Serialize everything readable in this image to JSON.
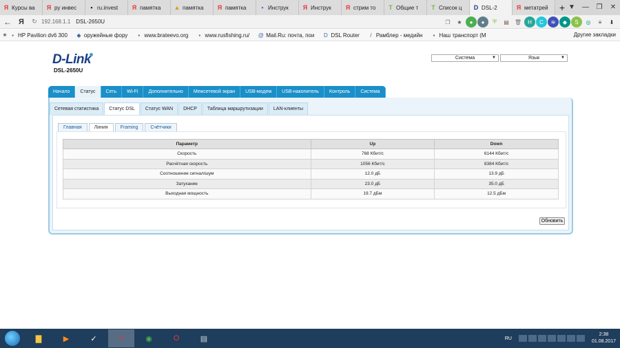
{
  "browser": {
    "tabs": [
      {
        "label": "Курсы ва",
        "icon": "Я",
        "icon_color": "#e53935"
      },
      {
        "label": "ру инвес",
        "icon": "Я",
        "icon_color": "#e53935"
      },
      {
        "label": "ru.invest",
        "icon": "▪",
        "icon_color": "#222222"
      },
      {
        "label": "памятка",
        "icon": "Я",
        "icon_color": "#e53935"
      },
      {
        "label": "памятка",
        "icon": "▲",
        "icon_color": "#d4a017"
      },
      {
        "label": "памятка",
        "icon": "Я",
        "icon_color": "#e53935"
      },
      {
        "label": "Инструк",
        "icon": "▪",
        "icon_color": "#5c6bc0"
      },
      {
        "label": "Инструк",
        "icon": "Я",
        "icon_color": "#e53935"
      },
      {
        "label": "стрим то",
        "icon": "Я",
        "icon_color": "#e53935"
      },
      {
        "label": "Общие т",
        "icon": "T",
        "icon_color": "#7cb342"
      },
      {
        "label": "Список ц",
        "icon": "T",
        "icon_color": "#7cb342"
      },
      {
        "label": "DSL-2",
        "icon": "D",
        "icon_color": "#1b3f86"
      },
      {
        "label": "метатрей",
        "icon": "Я",
        "icon_color": "#e53935"
      }
    ],
    "active_tab_index": 11,
    "new_tab": "+",
    "window_controls": [
      "▼",
      "—",
      "❐",
      "✕"
    ],
    "address": {
      "yandex_logo": "Я",
      "url": "192.168.1.1",
      "page_title": "DSL-2650U"
    },
    "bookmarks": [
      {
        "label": "HP Pavilion dv6 300",
        "icon": "▪"
      },
      {
        "label": "оружейные фору",
        "icon": "◆"
      },
      {
        "label": "www.brateevo.org",
        "icon": "▪"
      },
      {
        "label": "www.rusfishing.ru/",
        "icon": "▪"
      },
      {
        "label": "Mail.Ru: почта, пои",
        "icon": "@"
      },
      {
        "label": "DSL Router",
        "icon": "D"
      },
      {
        "label": "Рамблер - медийн",
        "icon": "/"
      },
      {
        "label": "Наш транспорт (М",
        "icon": "▪"
      }
    ],
    "other_bookmarks": "Другие закладки"
  },
  "router": {
    "logo_text": "D-Link",
    "model": "DSL-2650U",
    "system_select": "Система",
    "language_select": "Язык",
    "main_menu": [
      "Начало",
      "Статус",
      "Сеть",
      "Wi-Fi",
      "Дополнительно",
      "Межсетевой экран",
      "USB-модем",
      "USB-накопитель",
      "Контроль",
      "Система"
    ],
    "main_menu_active": 1,
    "sub_menu": [
      "Сетевая статистика",
      "Статус DSL",
      "Статус WAN",
      "DHCP",
      "Таблица маршрутизации",
      "LAN-клиенты"
    ],
    "sub_menu_active": 1,
    "inner_tabs": [
      "Главная",
      "Линия",
      "Framing",
      "Счётчики"
    ],
    "inner_tabs_active": 1,
    "table": {
      "headers": [
        "Параметр",
        "Up",
        "Down"
      ],
      "rows": [
        [
          "Скорость",
          "768 Кбит/с",
          "6144 Кбит/с"
        ],
        [
          "Расчётная скорость",
          "1056 Кбит/с",
          "8384 Кбит/с"
        ],
        [
          "Соотношение сигнал/шум",
          "12.0 дБ",
          "13.9 дБ"
        ],
        [
          "Затухание",
          "23.0 дБ",
          "35.0 дБ"
        ],
        [
          "Выходная мощность",
          "19.7 дБм",
          "12.5 дБм"
        ]
      ]
    },
    "refresh_button": "Обновить"
  },
  "taskbar": {
    "language": "RU",
    "time": "2:38",
    "date": "01.08.2017",
    "apps": [
      "folder-icon",
      "media-player-icon",
      "mail-icon",
      "yandex-browser-icon",
      "chrome-icon",
      "opera-icon",
      "explorer-icon"
    ]
  }
}
